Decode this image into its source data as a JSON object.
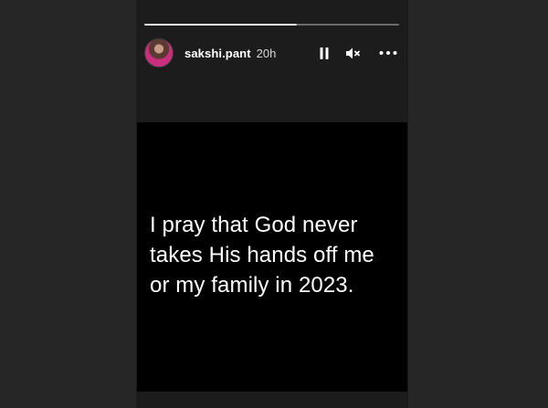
{
  "story": {
    "progress": 0.6,
    "username": "sakshi.pant",
    "posted_ago": "20h",
    "controls": {
      "pause_icon": "pause-icon",
      "mute_icon": "muted-speaker-icon",
      "more_icon": "more-options-icon"
    },
    "quote_text": "I pray that God never\ntakes His hands off me\nor my family in 2023."
  },
  "colors": {
    "page_bg": "#262626",
    "story_bg": "#1c1c1c",
    "panel_bg": "#000000",
    "text": "#ffffff"
  }
}
